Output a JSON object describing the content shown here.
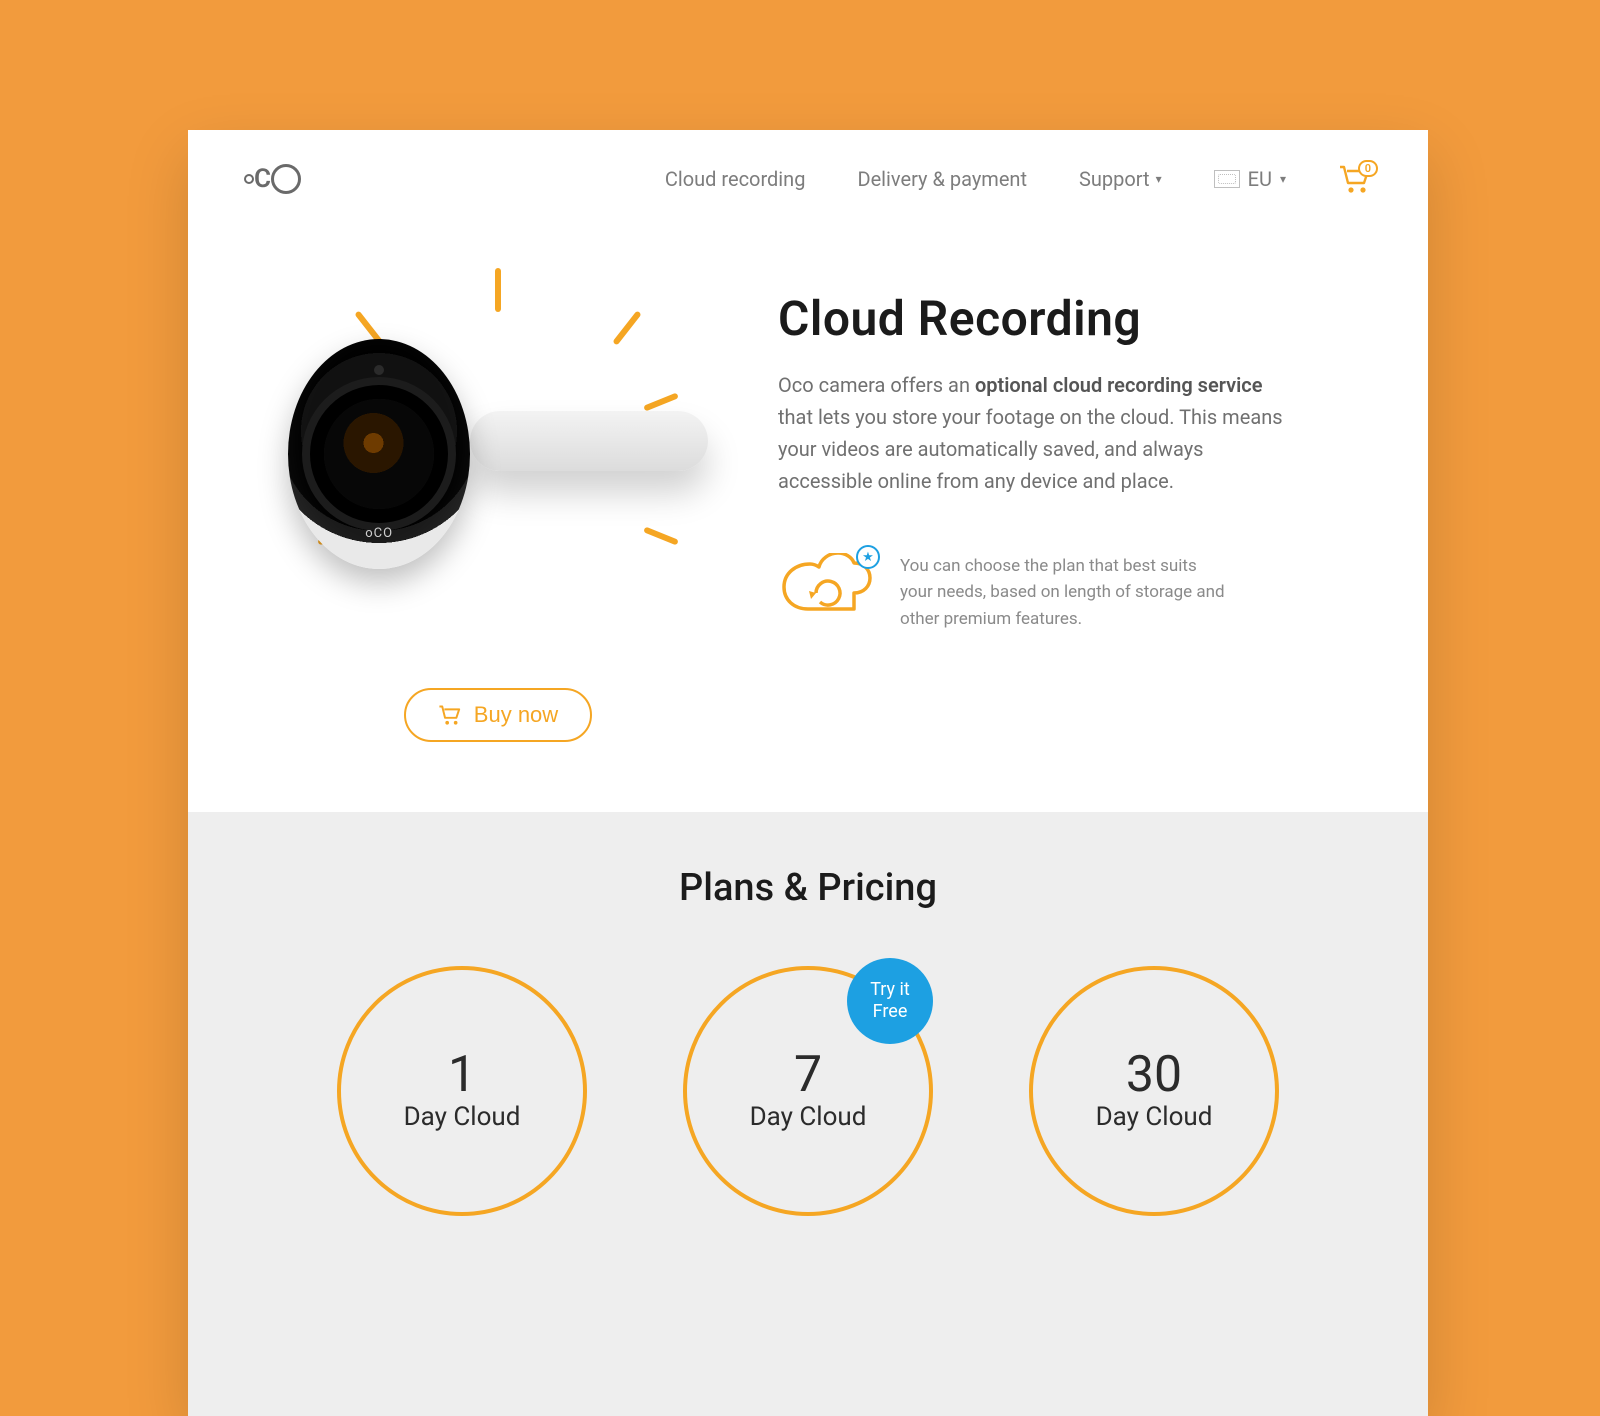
{
  "colors": {
    "accent": "#f5a623",
    "blue": "#1da0e2",
    "text_muted": "#7d7d7d"
  },
  "header": {
    "logo_name": "oco",
    "nav": {
      "cloud_recording": "Cloud recording",
      "delivery_payment": "Delivery & payment",
      "support": "Support",
      "region": "EU"
    },
    "cart_count": "0"
  },
  "hero": {
    "title": "Cloud Recording",
    "desc_prefix": "Oco camera offers an ",
    "desc_bold": "optional cloud recording service",
    "desc_suffix": " that lets you store your footage on the cloud. This means your videos are automatically saved, and always accessible online from any device and place.",
    "hint": "You can choose the plan that best suits your needs, based on length of storage and other premium features.",
    "camera_brand": "oCO",
    "buy_label": "Buy now"
  },
  "plans": {
    "title": "Plans & Pricing",
    "items": [
      {
        "num": "1",
        "label": "Day Cloud",
        "badge": ""
      },
      {
        "num": "7",
        "label": "Day Cloud",
        "badge": "Try it\nFree"
      },
      {
        "num": "30",
        "label": "Day Cloud",
        "badge": ""
      }
    ]
  }
}
